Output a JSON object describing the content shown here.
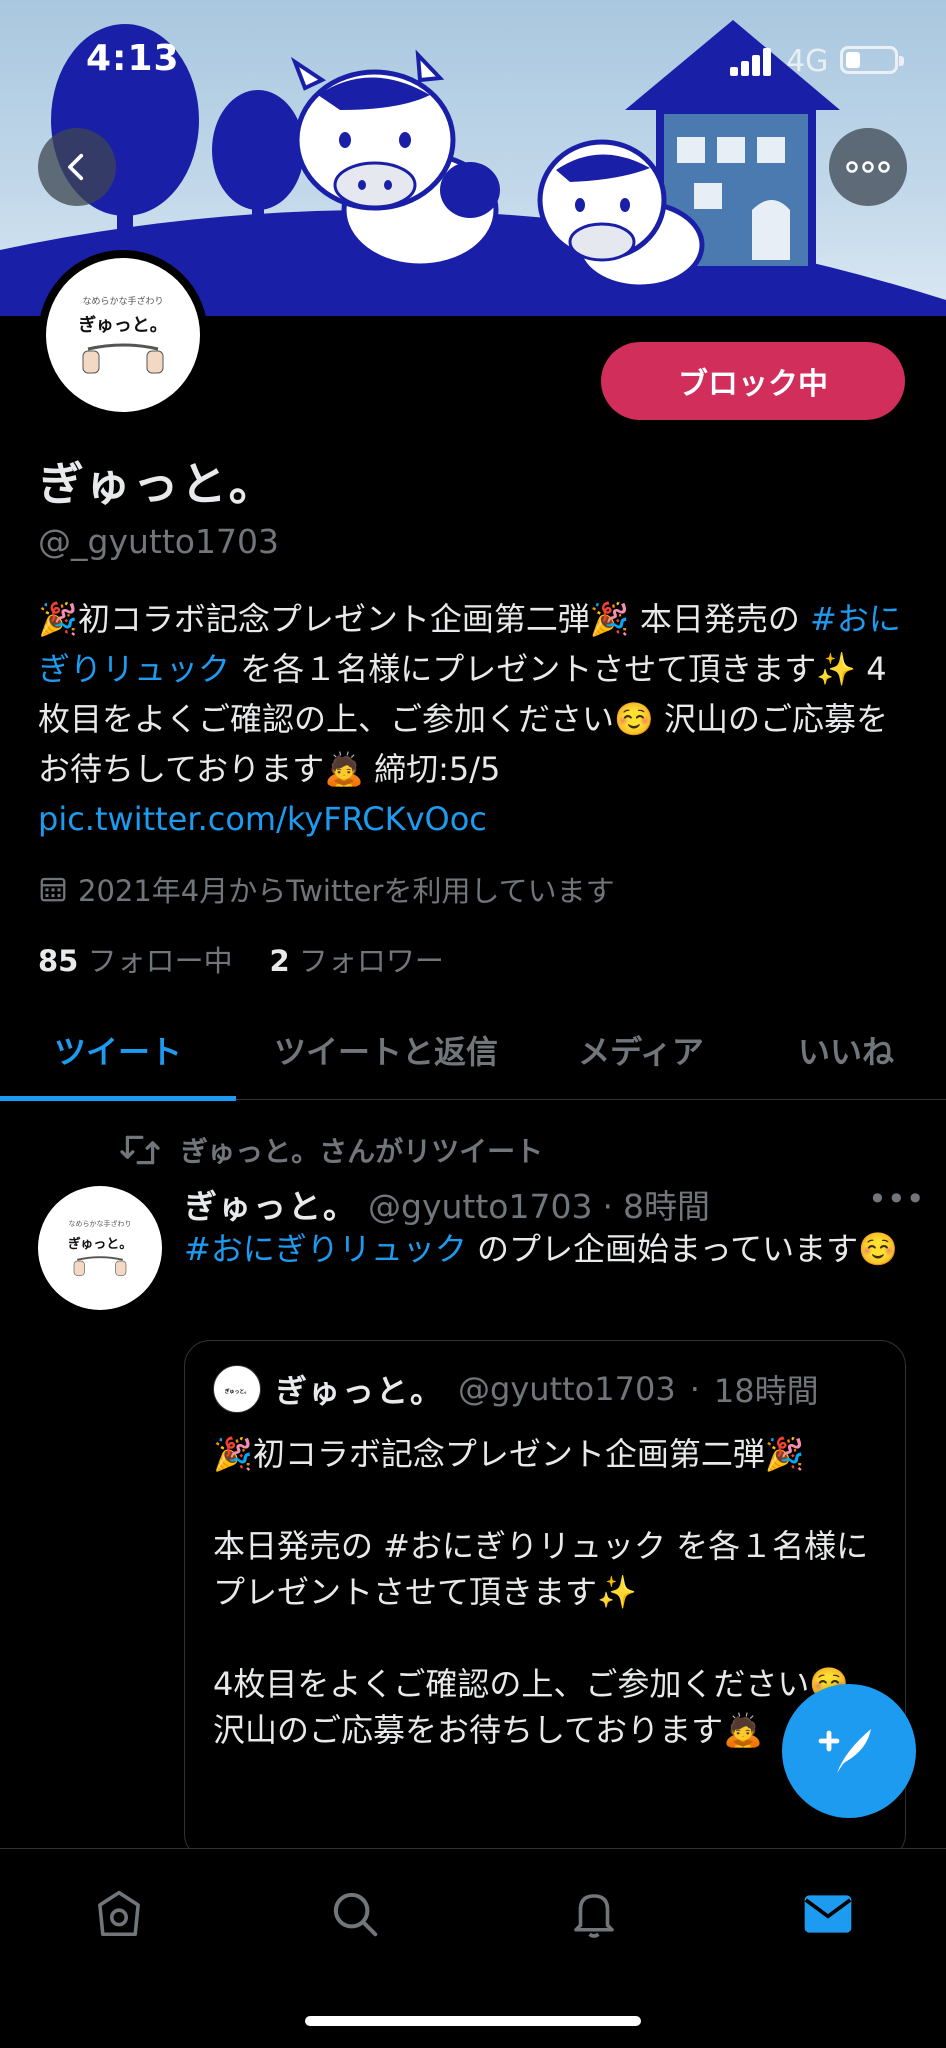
{
  "status_bar": {
    "time": "4:13",
    "network": "4G"
  },
  "profile": {
    "logo_subtext": "なめらかな手ざわり",
    "logo_text": "ぎゅっと。",
    "block_button": "ブロック中",
    "name": "ぎゅっと。",
    "handle": "@_gyutto1703",
    "bio": {
      "line1_pre": "🎉初コラボ記念プレゼント企画第二弾🎉 本日発売の ",
      "hashtag": "#おにぎりリュック",
      "line_mid": " を各１名様にプレゼントさせて頂きます✨ 4枚目をよくご確認の上、ご参加ください☺️ 沢山のご応募をお待ちしております🙇 締切:5/5",
      "link": "pic.twitter.com/kyFRCKvOoc"
    },
    "joined": "2021年4月からTwitterを利用しています",
    "following_count": "85",
    "following_label": "フォロー中",
    "followers_count": "2",
    "followers_label": "フォロワー"
  },
  "tabs": [
    "ツイート",
    "ツイートと返信",
    "メディア",
    "いいね"
  ],
  "tweet": {
    "retweet_label": "ぎゅっと。さんがリツイート",
    "author_name": "ぎゅっと。",
    "author_handle": "@gyutto1703",
    "separator": "·",
    "time": "8時間",
    "hashtag": "#おにぎりリュック",
    "text_rest": " のプレ企画始まっています☺️",
    "quote": {
      "author_name": "ぎゅっと。",
      "author_handle": "@gyutto1703",
      "time": "18時間",
      "body": "🎉初コラボ記念プレゼント企画第二弾🎉\n\n本日発売の #おにぎりリュック を各１名様にプレゼントさせて頂きます✨\n\n4枚目をよくご確認の上、ご参加ください☺️\n沢山のご応募をお待ちしております🙇"
    }
  },
  "colors": {
    "accent": "#1d9bf0",
    "block": "#d12e5b",
    "cow_blue": "#1a1fa8"
  },
  "icons": [
    "back-icon",
    "more-icon",
    "calendar-icon",
    "retweet-icon",
    "compose-icon",
    "home-icon",
    "search-icon",
    "notifications-icon",
    "messages-icon"
  ]
}
